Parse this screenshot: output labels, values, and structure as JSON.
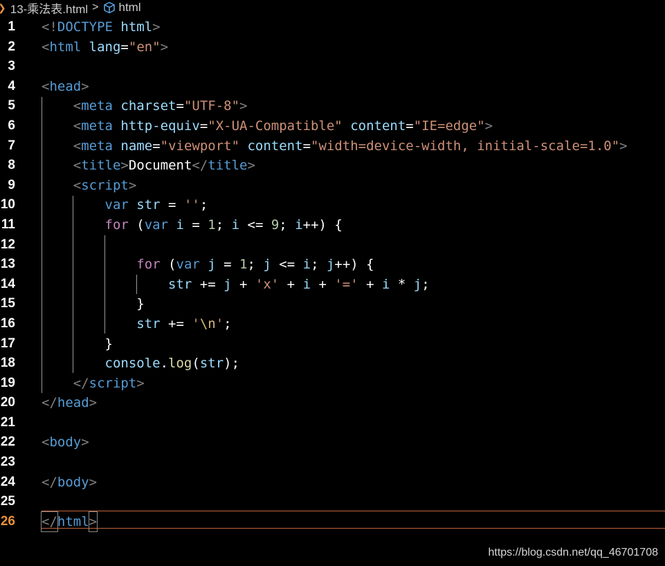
{
  "breadcrumb": {
    "folder": "13-乘法表.html",
    "element": "html"
  },
  "active_line": 26,
  "code_lines": [
    [
      [
        "tk-punct",
        "<!"
      ],
      [
        "tk-tag",
        "DOCTYPE "
      ],
      [
        "tk-attr",
        "html"
      ],
      [
        "tk-punct",
        ">"
      ]
    ],
    [
      [
        "tk-punct",
        "<"
      ],
      [
        "tk-tag",
        "html "
      ],
      [
        "tk-attr",
        "lang"
      ],
      [
        "tk-text",
        "="
      ],
      [
        "tk-str",
        "\"en\""
      ],
      [
        "tk-punct",
        ">"
      ]
    ],
    [],
    [
      [
        "tk-punct",
        "<"
      ],
      [
        "tk-tag",
        "head"
      ],
      [
        "tk-punct",
        ">"
      ]
    ],
    [
      [
        "tk-text",
        "    "
      ],
      [
        "tk-punct",
        "<"
      ],
      [
        "tk-tag",
        "meta "
      ],
      [
        "tk-attr",
        "charset"
      ],
      [
        "tk-text",
        "="
      ],
      [
        "tk-str",
        "\"UTF-8\""
      ],
      [
        "tk-punct",
        ">"
      ]
    ],
    [
      [
        "tk-text",
        "    "
      ],
      [
        "tk-punct",
        "<"
      ],
      [
        "tk-tag",
        "meta "
      ],
      [
        "tk-attr",
        "http-equiv"
      ],
      [
        "tk-text",
        "="
      ],
      [
        "tk-str",
        "\"X-UA-Compatible\""
      ],
      [
        "tk-text",
        " "
      ],
      [
        "tk-attr",
        "content"
      ],
      [
        "tk-text",
        "="
      ],
      [
        "tk-str",
        "\"IE=edge\""
      ],
      [
        "tk-punct",
        ">"
      ]
    ],
    [
      [
        "tk-text",
        "    "
      ],
      [
        "tk-punct",
        "<"
      ],
      [
        "tk-tag",
        "meta "
      ],
      [
        "tk-attr",
        "name"
      ],
      [
        "tk-text",
        "="
      ],
      [
        "tk-str",
        "\"viewport\""
      ],
      [
        "tk-text",
        " "
      ],
      [
        "tk-attr",
        "content"
      ],
      [
        "tk-text",
        "="
      ],
      [
        "tk-str",
        "\"width=device-width, initial-scale=1.0\""
      ],
      [
        "tk-punct",
        ">"
      ]
    ],
    [
      [
        "tk-text",
        "    "
      ],
      [
        "tk-punct",
        "<"
      ],
      [
        "tk-tag",
        "title"
      ],
      [
        "tk-punct",
        ">"
      ],
      [
        "tk-text",
        "Document"
      ],
      [
        "tk-punct",
        "</"
      ],
      [
        "tk-tag",
        "title"
      ],
      [
        "tk-punct",
        ">"
      ]
    ],
    [
      [
        "tk-text",
        "    "
      ],
      [
        "tk-punct",
        "<"
      ],
      [
        "tk-tag",
        "script"
      ],
      [
        "tk-punct",
        ">"
      ]
    ],
    [
      [
        "tk-text",
        "        "
      ],
      [
        "tk-kw",
        "var "
      ],
      [
        "tk-var",
        "str"
      ],
      [
        "tk-text",
        " = "
      ],
      [
        "tk-str",
        "''"
      ],
      [
        "tk-text",
        ";"
      ]
    ],
    [
      [
        "tk-text",
        "        "
      ],
      [
        "tk-ctrl",
        "for"
      ],
      [
        "tk-text",
        " ("
      ],
      [
        "tk-kw",
        "var "
      ],
      [
        "tk-var",
        "i"
      ],
      [
        "tk-text",
        " = "
      ],
      [
        "tk-num",
        "1"
      ],
      [
        "tk-text",
        "; "
      ],
      [
        "tk-var",
        "i"
      ],
      [
        "tk-text",
        " <= "
      ],
      [
        "tk-num",
        "9"
      ],
      [
        "tk-text",
        "; "
      ],
      [
        "tk-var",
        "i"
      ],
      [
        "tk-text",
        "++) {"
      ]
    ],
    [],
    [
      [
        "tk-text",
        "            "
      ],
      [
        "tk-ctrl",
        "for"
      ],
      [
        "tk-text",
        " ("
      ],
      [
        "tk-kw",
        "var "
      ],
      [
        "tk-var",
        "j"
      ],
      [
        "tk-text",
        " = "
      ],
      [
        "tk-num",
        "1"
      ],
      [
        "tk-text",
        "; "
      ],
      [
        "tk-var",
        "j"
      ],
      [
        "tk-text",
        " <= "
      ],
      [
        "tk-var",
        "i"
      ],
      [
        "tk-text",
        "; "
      ],
      [
        "tk-var",
        "j"
      ],
      [
        "tk-text",
        "++) {"
      ]
    ],
    [
      [
        "tk-text",
        "                "
      ],
      [
        "tk-var",
        "str"
      ],
      [
        "tk-text",
        " += "
      ],
      [
        "tk-var",
        "j"
      ],
      [
        "tk-text",
        " + "
      ],
      [
        "tk-str",
        "'x'"
      ],
      [
        "tk-text",
        " + "
      ],
      [
        "tk-var",
        "i"
      ],
      [
        "tk-text",
        " + "
      ],
      [
        "tk-str",
        "'='"
      ],
      [
        "tk-text",
        " + "
      ],
      [
        "tk-var",
        "i"
      ],
      [
        "tk-text",
        " * "
      ],
      [
        "tk-var",
        "j"
      ],
      [
        "tk-text",
        ";"
      ]
    ],
    [
      [
        "tk-text",
        "            }"
      ]
    ],
    [
      [
        "tk-text",
        "            "
      ],
      [
        "tk-var",
        "str"
      ],
      [
        "tk-text",
        " += "
      ],
      [
        "tk-str",
        "'"
      ],
      [
        "tk-esc",
        "\\n"
      ],
      [
        "tk-str",
        "'"
      ],
      [
        "tk-text",
        ";"
      ]
    ],
    [
      [
        "tk-text",
        "        }"
      ]
    ],
    [
      [
        "tk-text",
        "        "
      ],
      [
        "tk-var",
        "console"
      ],
      [
        "tk-text",
        "."
      ],
      [
        "tk-fn",
        "log"
      ],
      [
        "tk-text",
        "("
      ],
      [
        "tk-var",
        "str"
      ],
      [
        "tk-text",
        ");"
      ]
    ],
    [
      [
        "tk-text",
        "    "
      ],
      [
        "tk-punct",
        "</"
      ],
      [
        "tk-tag",
        "script"
      ],
      [
        "tk-punct",
        ">"
      ]
    ],
    [
      [
        "tk-punct",
        "</"
      ],
      [
        "tk-tag",
        "head"
      ],
      [
        "tk-punct",
        ">"
      ]
    ],
    [],
    [
      [
        "tk-punct",
        "<"
      ],
      [
        "tk-tag",
        "body"
      ],
      [
        "tk-punct",
        ">"
      ]
    ],
    [],
    [
      [
        "tk-punct",
        "</"
      ],
      [
        "tk-tag",
        "body"
      ],
      [
        "tk-punct",
        ">"
      ]
    ],
    [],
    [
      [
        "tk-punct",
        "</"
      ],
      [
        "tk-tag",
        "html"
      ],
      [
        "tk-punct",
        ">"
      ]
    ]
  ],
  "watermark": "https://blog.csdn.net/qq_46701708",
  "colors": {
    "background": "#000000",
    "line_number": "#ffffff",
    "active_line_number": "#e8913a",
    "current_line_border": "#c2653a",
    "tag": "#569cd6",
    "attribute": "#9cdcfe",
    "string": "#ce9178",
    "control_keyword": "#c586c0",
    "number": "#b5cea8",
    "function": "#dcdcaa"
  }
}
